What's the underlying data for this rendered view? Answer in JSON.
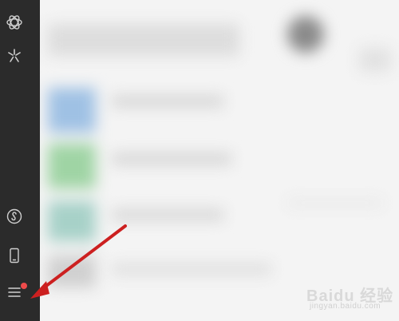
{
  "sidebar": {
    "items": [
      {
        "name": "moments-icon",
        "label": ""
      },
      {
        "name": "discover-icon",
        "label": ""
      },
      {
        "name": "mini-program-icon",
        "label": ""
      },
      {
        "name": "phone-icon",
        "label": ""
      },
      {
        "name": "menu-icon",
        "label": ""
      }
    ],
    "menu_badge_color": "#ee4b4b"
  },
  "colors": {
    "sidebar_bg": "#2b2b2b",
    "arrow": "#cc2020",
    "badge": "#ee4b4b"
  },
  "watermark": {
    "brand": "Baidu 经验",
    "url": "jingyan.baidu.com"
  }
}
